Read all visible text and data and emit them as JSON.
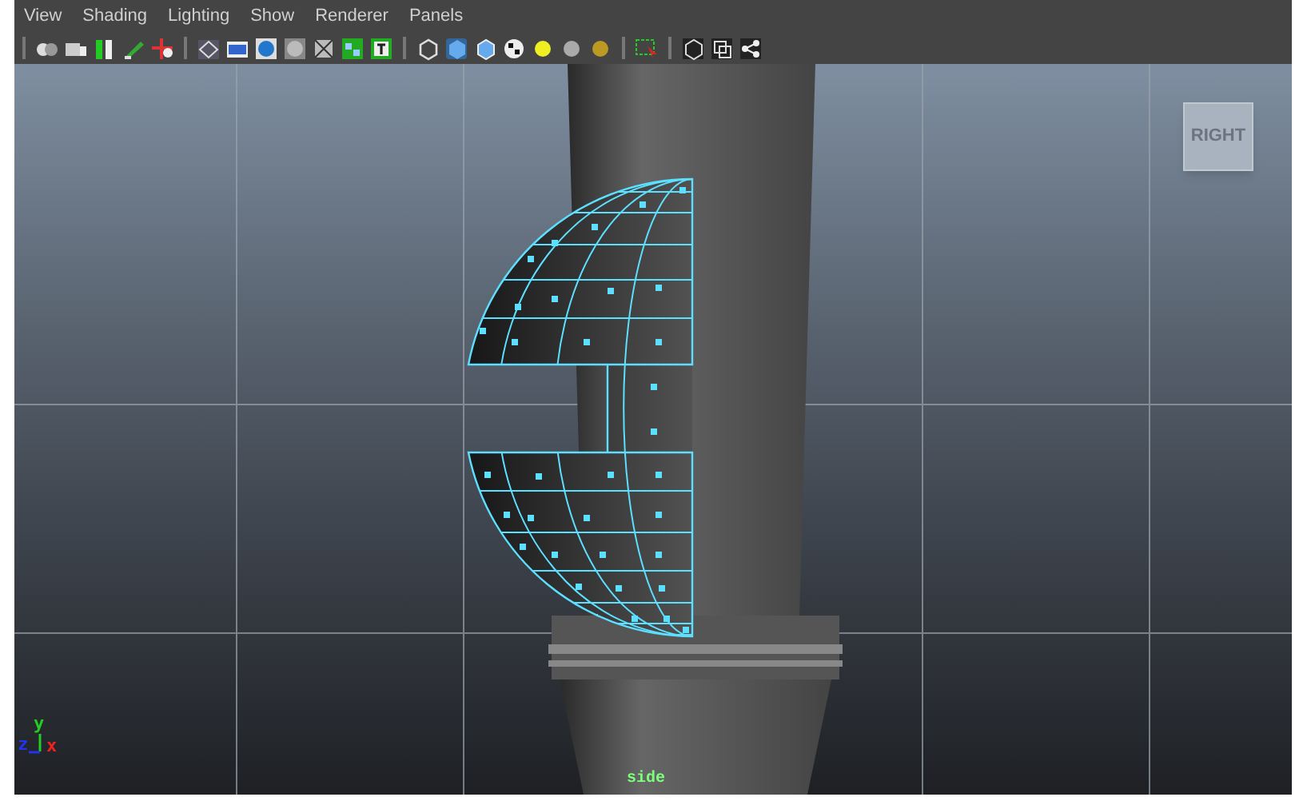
{
  "menu": [
    "View",
    "Shading",
    "Lighting",
    "Show",
    "Renderer",
    "Panels"
  ],
  "viewport": {
    "view_cube_label": "RIGHT",
    "camera_label": "side",
    "axis_labels": [
      {
        "text": "y",
        "color": "#22cc22"
      },
      {
        "text": "z",
        "color": "#2233ee"
      },
      {
        "text": "x",
        "color": "#ee2222"
      }
    ]
  }
}
